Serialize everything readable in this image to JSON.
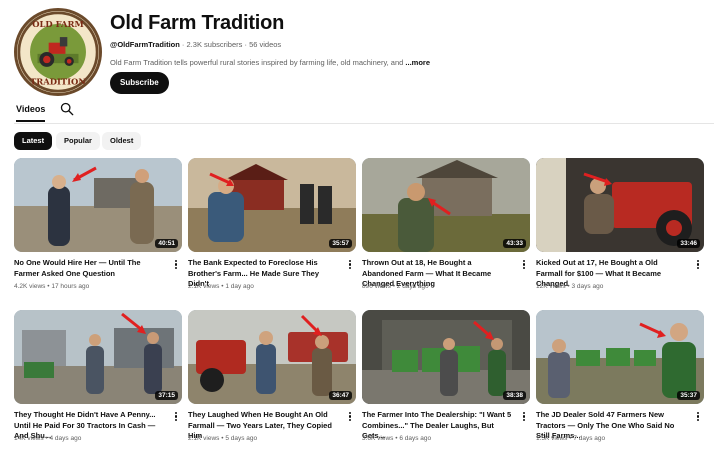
{
  "channel": {
    "name": "Old Farm Tradition",
    "handle": "@OldFarmTradition",
    "subscribers": "2.3K subscribers",
    "videos_count": "56 videos",
    "description": "Old Farm Tradition tells powerful rural stories inspired by farming life, old machinery, and",
    "more_label": "...more",
    "subscribe_label": "Subscribe",
    "logo_text_top": "OLD FARM",
    "logo_text_bottom": "TRADITION"
  },
  "tabs": {
    "videos_label": "Videos"
  },
  "chips": [
    "Latest",
    "Popular",
    "Oldest"
  ],
  "videos": [
    {
      "title": "No One Would Hire Her — Until The Farmer Asked One Question",
      "views": "4.2K views",
      "age": "17 hours ago",
      "duration": "40:51"
    },
    {
      "title": "The Bank Expected to Foreclose His Brother's Farm... He Made Sure They Didn't",
      "views": "2.1K views",
      "age": "1 day ago",
      "duration": "35:57"
    },
    {
      "title": "Thrown Out at 18, He Bought a Abandoned Farm — What It Became Changed Everything",
      "views": "890 views",
      "age": "2 days ago",
      "duration": "43:33"
    },
    {
      "title": "Kicked Out at 17, He Bought a Old Farmall for $100 — What It Became Changed",
      "views": "12K views",
      "age": "3 days ago",
      "duration": "33:46"
    },
    {
      "title": "They Thought He Didn't Have A Penny... Until He Paid For 30 Tractors In Cash — And Shu...",
      "views": "14K views",
      "age": "4 days ago",
      "duration": "37:15"
    },
    {
      "title": "They Laughed When He Bought An Old Farmall — Two Years Later, They Copied Him",
      "views": "2.1K views",
      "age": "5 days ago",
      "duration": "36:47"
    },
    {
      "title": "The Farmer Into The Dealership: \"I Want 5 Combines...\" The Dealer Laughs, But Gets...",
      "views": "3.6K views",
      "age": "6 days ago",
      "duration": "38:38"
    },
    {
      "title": "The JD Dealer Sold 47 Farmers New Tractors — Only The One Who Said No Still Farms...",
      "views": "1.5K views",
      "age": "7 days ago",
      "duration": "35:37"
    }
  ],
  "colors": {
    "accent": "#0f0f0f",
    "meta": "#606060",
    "chip_bg": "#f2f2f2",
    "arrow": "#e02020"
  }
}
